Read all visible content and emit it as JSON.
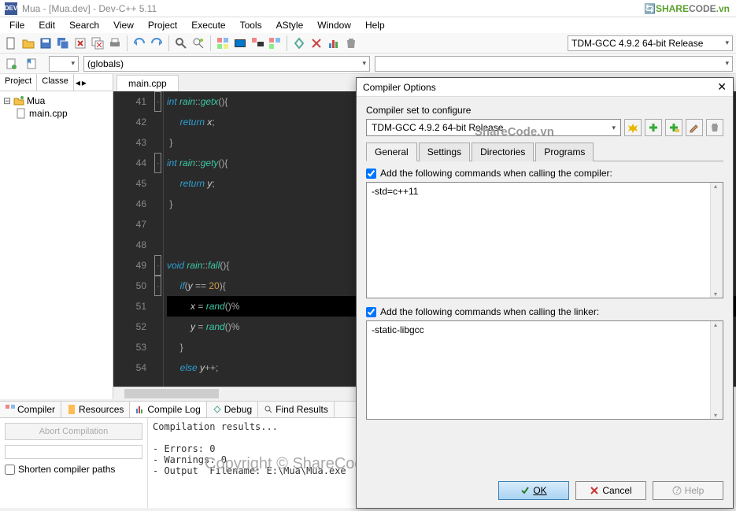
{
  "titlebar": {
    "title": "Mua - [Mua.dev] - Dev-C++ 5.11"
  },
  "brand": {
    "p1": "SHARE",
    "p2": "CODE",
    "p3": ".vn"
  },
  "menu": [
    "File",
    "Edit",
    "Search",
    "View",
    "Project",
    "Execute",
    "Tools",
    "AStyle",
    "Window",
    "Help"
  ],
  "compiler_selector": "TDM-GCC 4.9.2 64-bit Release",
  "globals_combo": "(globals)",
  "sidebar": {
    "tabs": [
      "Project",
      "Classe"
    ],
    "project_name": "Mua",
    "file_name": "main.cpp"
  },
  "editor": {
    "tab": "main.cpp",
    "lines": [
      {
        "n": 41,
        "fold": "-",
        "spans": [
          [
            "kw",
            "int"
          ],
          [
            "op",
            " "
          ],
          [
            "cls",
            "rain"
          ],
          [
            "pun",
            "::"
          ],
          [
            "fn",
            "getx"
          ],
          [
            "pun",
            "(){"
          ]
        ]
      },
      {
        "n": 42,
        "fold": "",
        "spans": [
          [
            "op",
            "     "
          ],
          [
            "kw",
            "return"
          ],
          [
            "op",
            " "
          ],
          [
            "var",
            "x"
          ],
          [
            "pun",
            ";"
          ]
        ]
      },
      {
        "n": 43,
        "fold": "",
        "spans": [
          [
            "pun",
            " }"
          ]
        ]
      },
      {
        "n": 44,
        "fold": "-",
        "spans": [
          [
            "kw",
            "int"
          ],
          [
            "op",
            " "
          ],
          [
            "cls",
            "rain"
          ],
          [
            "pun",
            "::"
          ],
          [
            "fn",
            "gety"
          ],
          [
            "pun",
            "(){"
          ]
        ]
      },
      {
        "n": 45,
        "fold": "",
        "spans": [
          [
            "op",
            "     "
          ],
          [
            "kw",
            "return"
          ],
          [
            "op",
            " "
          ],
          [
            "var",
            "y"
          ],
          [
            "pun",
            ";"
          ]
        ]
      },
      {
        "n": 46,
        "fold": "",
        "spans": [
          [
            "pun",
            " }"
          ]
        ]
      },
      {
        "n": 47,
        "fold": "",
        "spans": []
      },
      {
        "n": 48,
        "fold": "",
        "spans": []
      },
      {
        "n": 49,
        "fold": "-",
        "spans": [
          [
            "kw",
            "void"
          ],
          [
            "op",
            " "
          ],
          [
            "cls",
            "rain"
          ],
          [
            "pun",
            "::"
          ],
          [
            "fn",
            "fall"
          ],
          [
            "pun",
            "(){"
          ]
        ]
      },
      {
        "n": 50,
        "fold": "-",
        "spans": [
          [
            "op",
            "     "
          ],
          [
            "kw",
            "if"
          ],
          [
            "pun",
            "("
          ],
          [
            "var",
            "y"
          ],
          [
            "op",
            " == "
          ],
          [
            "num",
            "20"
          ],
          [
            "pun",
            "){"
          ]
        ]
      },
      {
        "n": 51,
        "fold": "",
        "sel": true,
        "spans": [
          [
            "op",
            "         "
          ],
          [
            "var",
            "x"
          ],
          [
            "op",
            " = "
          ],
          [
            "fn",
            "rand"
          ],
          [
            "pun",
            "()%"
          ]
        ]
      },
      {
        "n": 52,
        "fold": "",
        "spans": [
          [
            "op",
            "         "
          ],
          [
            "var",
            "y"
          ],
          [
            "op",
            " = "
          ],
          [
            "fn",
            "rand"
          ],
          [
            "pun",
            "()%"
          ]
        ]
      },
      {
        "n": 53,
        "fold": "",
        "spans": [
          [
            "op",
            "     "
          ],
          [
            "pun",
            "}"
          ]
        ]
      },
      {
        "n": 54,
        "fold": "",
        "spans": [
          [
            "op",
            "     "
          ],
          [
            "kw",
            "else"
          ],
          [
            "op",
            " "
          ],
          [
            "var",
            "y"
          ],
          [
            "pun",
            "++;"
          ]
        ]
      }
    ]
  },
  "bottom_tabs": [
    "Compiler",
    "Resources",
    "Compile Log",
    "Debug",
    "Find Results"
  ],
  "abort_label": "Abort Compilation",
  "shorten_label": "Shorten compiler paths",
  "compile_log": "Compilation results...\n\n- Errors: 0\n- Warnings: 0\n- Output  Filename: E:\\Mua\\Mua.exe",
  "dialog": {
    "title": "Compiler Options",
    "set_label": "Compiler set to configure",
    "set_value": "TDM-GCC 4.9.2 64-bit Release",
    "tabs": [
      "General",
      "Settings",
      "Directories",
      "Programs"
    ],
    "chk1": "Add the following commands when calling the compiler:",
    "txt1_value": "-std=c++11",
    "chk2": "Add the following commands when calling the linker:",
    "txt2_value": "-static-libgcc",
    "ok": "OK",
    "cancel": "Cancel",
    "help": "Help"
  },
  "watermarks": {
    "sc": "ShareCode.vn",
    "copy": "Copyright © ShareCode.vn"
  }
}
